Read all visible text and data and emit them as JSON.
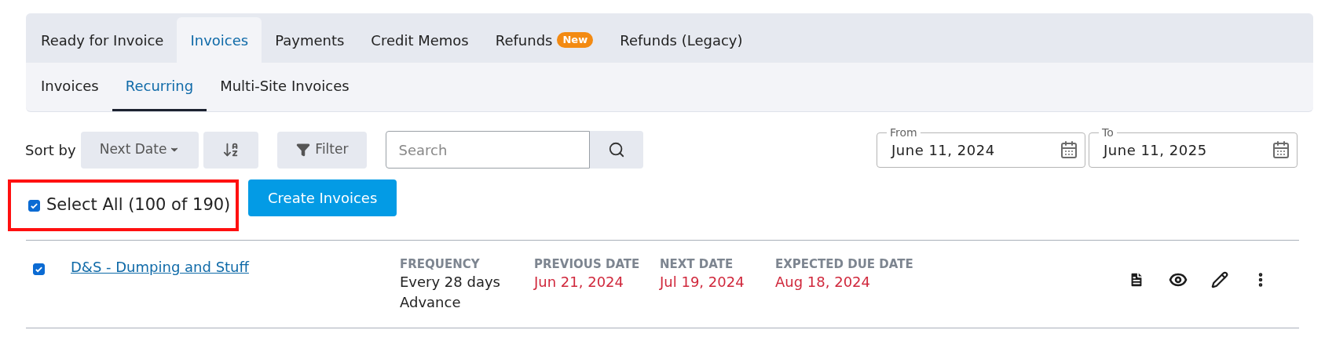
{
  "tabs": [
    {
      "label": "Ready for Invoice",
      "selected": false
    },
    {
      "label": "Invoices",
      "selected": true
    },
    {
      "label": "Payments",
      "selected": false
    },
    {
      "label": "Credit Memos",
      "selected": false
    },
    {
      "label": "Refunds",
      "selected": false,
      "badge": "New"
    },
    {
      "label": "Refunds (Legacy)",
      "selected": false
    }
  ],
  "subtabs": [
    {
      "label": "Invoices",
      "selected": false
    },
    {
      "label": "Recurring",
      "selected": true
    },
    {
      "label": "Multi-Site Invoices",
      "selected": false
    }
  ],
  "toolbar": {
    "sort_label": "Sort by",
    "sort_value": "Next Date",
    "filter": "Filter",
    "search": {
      "placeholder": "Search"
    },
    "date_from": {
      "label": "From",
      "value": "June 11, 2024"
    },
    "date_to": {
      "label": "To",
      "value": "June 11, 2025"
    }
  },
  "select_all": {
    "label": "Select All (100 of 190)",
    "checked": true,
    "highlighted": true
  },
  "create_button": "Create Invoices",
  "rows": [
    {
      "name": "D&S - Dumping and Stuff",
      "checked": true,
      "fields": [
        {
          "label": "FREQUENCY",
          "lines": [
            "Every 28 days",
            "Advance"
          ],
          "overdue": false
        },
        {
          "label": "PREVIOUS DATE",
          "lines": [
            "Jun 21, 2024"
          ],
          "overdue": true
        },
        {
          "label": "NEXT DATE",
          "lines": [
            "Jul 19, 2024"
          ],
          "overdue": true
        },
        {
          "label": "EXPECTED DUE DATE",
          "lines": [
            "Aug 18, 2024"
          ],
          "overdue": true
        }
      ]
    }
  ]
}
